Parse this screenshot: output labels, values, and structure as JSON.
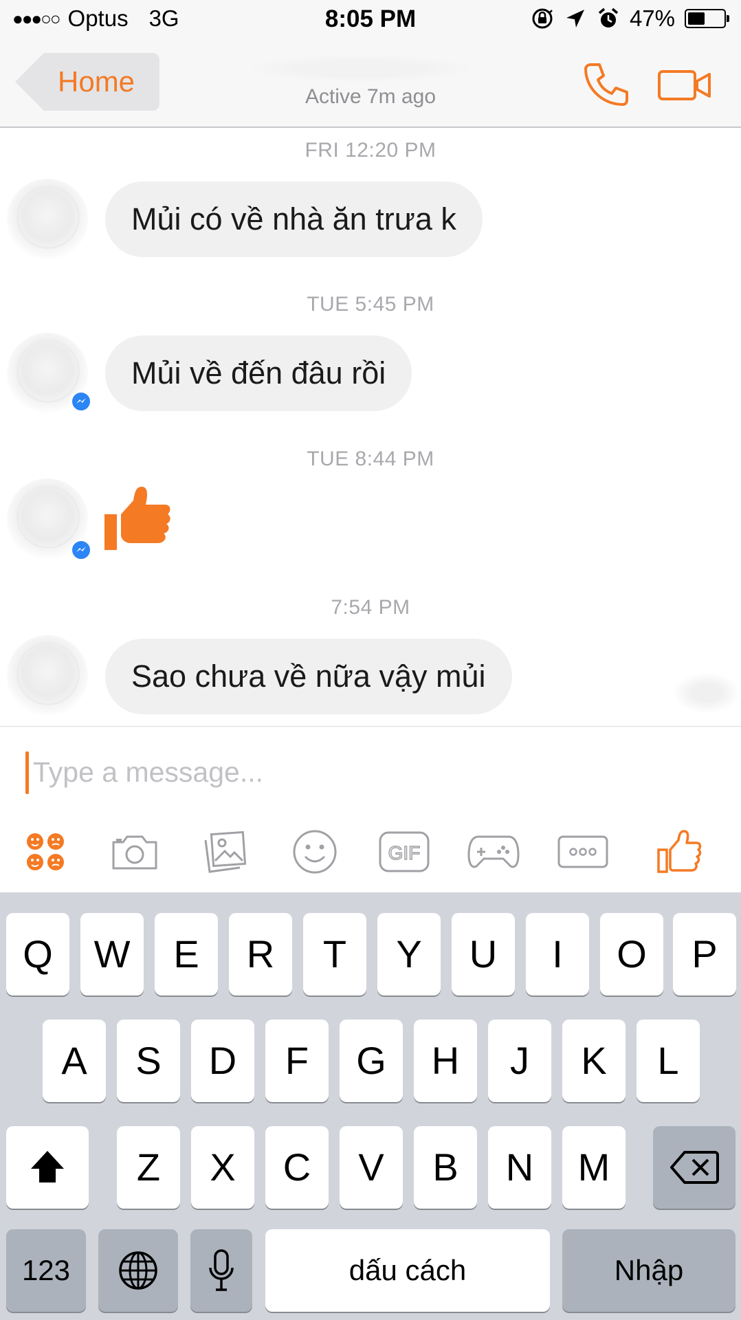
{
  "status_bar": {
    "signal_dots": "●●●○○",
    "carrier": "Optus",
    "network": "3G",
    "time": "8:05 PM",
    "battery_percent": "47%",
    "battery_level": 0.47,
    "icons": [
      "orientation-lock-icon",
      "location-arrow-icon",
      "alarm-icon",
      "battery-icon"
    ]
  },
  "nav": {
    "back_label": "Home",
    "subtitle": "Active 7m ago",
    "actions": [
      "phone-icon",
      "video-camera-icon"
    ],
    "accent_color": "#f47a24"
  },
  "messages": [
    {
      "timestamp": "FRI 12:20 PM",
      "text": "Mủi có về nhà ăn trưa k"
    },
    {
      "timestamp": "TUE 5:45 PM",
      "text": "Mủi về đến đâu rồi"
    },
    {
      "timestamp": "TUE 8:44 PM",
      "sticker": "thumbs-up-icon"
    },
    {
      "timestamp": "7:54 PM",
      "text": "Sao chưa về nữa vậy mủi"
    }
  ],
  "composer": {
    "placeholder": "Type a message...",
    "tools": [
      "emoji-stickers-icon",
      "camera-icon",
      "gallery-icon",
      "smiley-icon",
      "gif-icon",
      "games-icon",
      "more-icon",
      "like-icon"
    ],
    "gif_label": "GIF"
  },
  "keyboard": {
    "row1": [
      "Q",
      "W",
      "E",
      "R",
      "T",
      "Y",
      "U",
      "I",
      "O",
      "P"
    ],
    "row2": [
      "A",
      "S",
      "D",
      "F",
      "G",
      "H",
      "J",
      "K",
      "L"
    ],
    "row3": [
      "Z",
      "X",
      "C",
      "V",
      "B",
      "N",
      "M"
    ],
    "numbers_label": "123",
    "space_label": "dấu cách",
    "return_label": "Nhập",
    "special_icons": [
      "shift-icon",
      "delete-icon",
      "globe-icon",
      "microphone-icon"
    ]
  }
}
